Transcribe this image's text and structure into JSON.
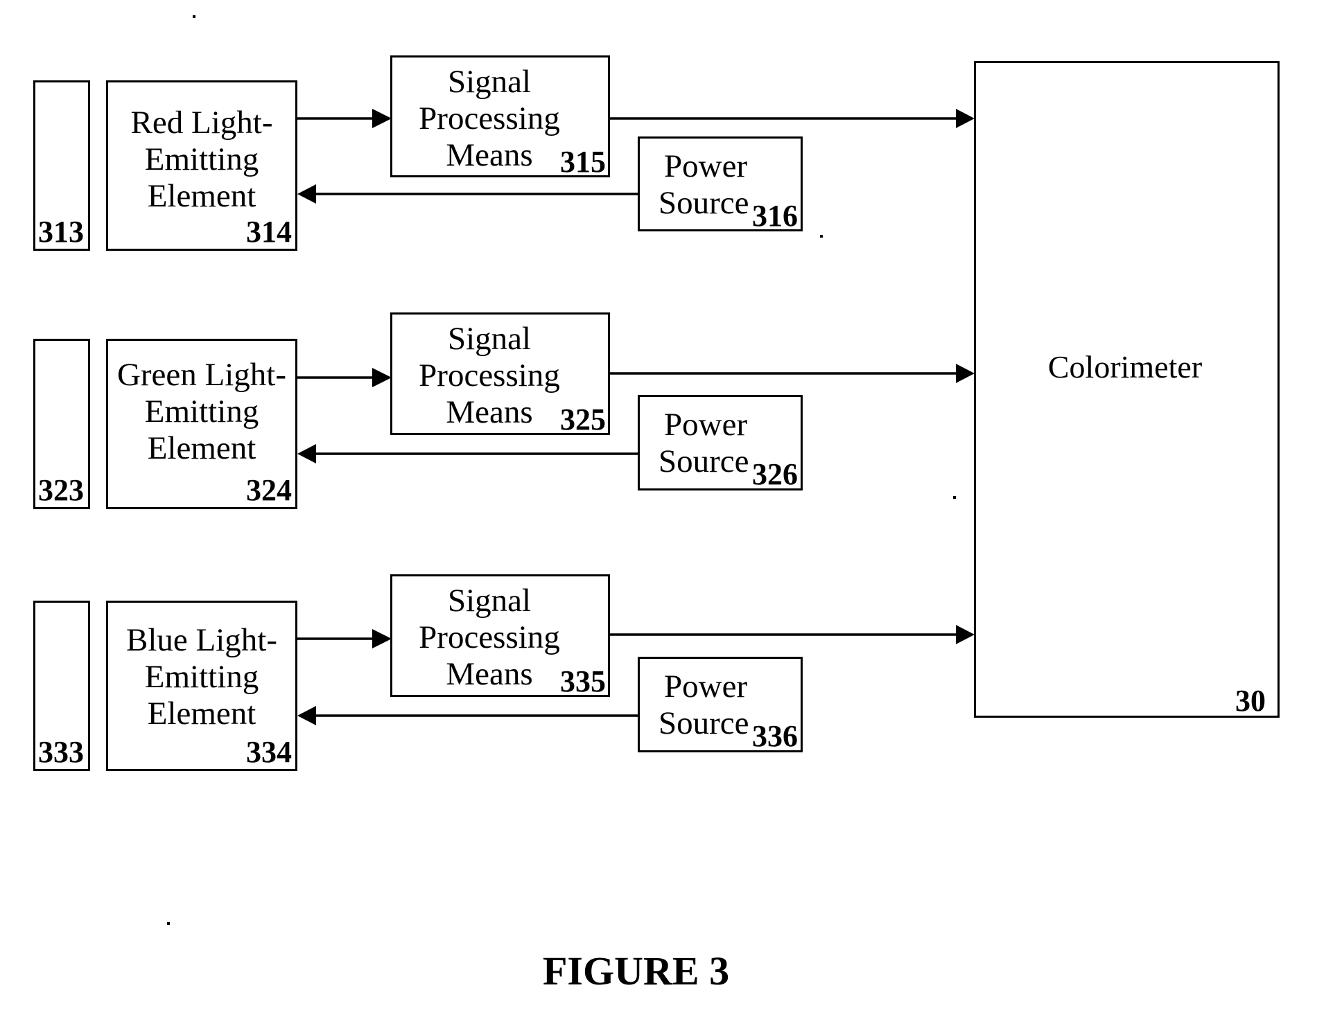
{
  "figure": {
    "caption": "FIGURE 3",
    "colorimeter": {
      "label": "Colorimeter",
      "ref": "30"
    },
    "channels": [
      {
        "color": "red",
        "target_ref": "313",
        "emitter": {
          "label_lines": [
            "Red Light-",
            "Emitting",
            "Element"
          ],
          "ref": "314"
        },
        "signal": {
          "label_lines": [
            "Signal",
            "Processing",
            "Means"
          ],
          "ref": "315"
        },
        "power": {
          "label_lines": [
            "Power",
            "Source"
          ],
          "ref": "316"
        }
      },
      {
        "color": "green",
        "target_ref": "323",
        "emitter": {
          "label_lines": [
            "Green Light-",
            "Emitting",
            "Element"
          ],
          "ref": "324"
        },
        "signal": {
          "label_lines": [
            "Signal",
            "Processing",
            "Means"
          ],
          "ref": "325"
        },
        "power": {
          "label_lines": [
            "Power",
            "Source"
          ],
          "ref": "326"
        }
      },
      {
        "color": "blue",
        "target_ref": "333",
        "emitter": {
          "label_lines": [
            "Blue Light-",
            "Emitting",
            "Element"
          ],
          "ref": "334"
        },
        "signal": {
          "label_lines": [
            "Signal",
            "Processing",
            "Means"
          ],
          "ref": "335"
        },
        "power": {
          "label_lines": [
            "Power",
            "Source"
          ],
          "ref": "336"
        }
      }
    ],
    "connections": [
      {
        "from": "314",
        "to": "315",
        "icon": "arrow-right-icon"
      },
      {
        "from": "315",
        "to": "30",
        "icon": "arrow-right-icon"
      },
      {
        "from": "316",
        "to": "314",
        "icon": "arrow-left-icon"
      },
      {
        "from": "324",
        "to": "325",
        "icon": "arrow-right-icon"
      },
      {
        "from": "325",
        "to": "30",
        "icon": "arrow-right-icon"
      },
      {
        "from": "326",
        "to": "324",
        "icon": "arrow-left-icon"
      },
      {
        "from": "334",
        "to": "335",
        "icon": "arrow-right-icon"
      },
      {
        "from": "335",
        "to": "30",
        "icon": "arrow-right-icon"
      },
      {
        "from": "336",
        "to": "334",
        "icon": "arrow-left-icon"
      }
    ]
  }
}
